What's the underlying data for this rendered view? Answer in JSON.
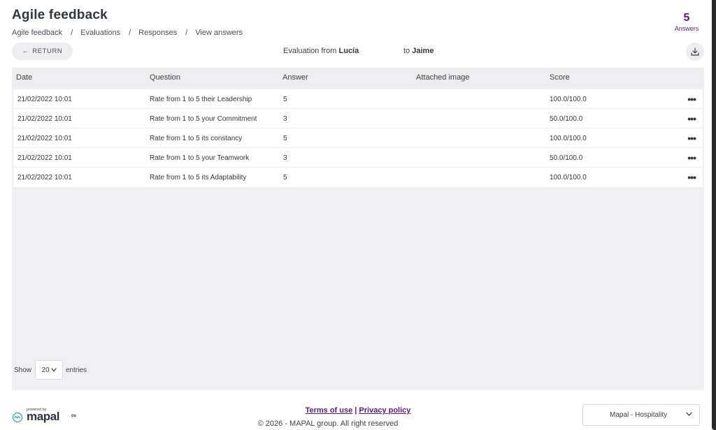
{
  "header": {
    "title": "Agile feedback",
    "breadcrumbs": [
      "Agile feedback",
      "Evaluations",
      "Responses",
      "View answers"
    ],
    "separator": "/",
    "answers_count": "5",
    "answers_label": "Answers"
  },
  "toolbar": {
    "return_label": "RETURN",
    "return_arrow": "←",
    "evaluation_prefix": "Evaluation from",
    "evaluation_from": "Lucía",
    "evaluation_to_prefix": "to",
    "evaluation_to": "Jaime",
    "download_icon": "download-icon"
  },
  "table": {
    "headers": [
      "Date",
      "Question",
      "Answer",
      "Attached image",
      "Score"
    ],
    "rows": [
      {
        "date": "21/02/2022 10:01",
        "question": "Rate from 1 to 5 their Leadership",
        "answer": "5",
        "attached_image": "",
        "score": "100.0/100.0",
        "more": "•••"
      },
      {
        "date": "21/02/2022 10:01",
        "question": "Rate from 1 to 5 your Commitment",
        "answer": "3",
        "attached_image": "",
        "score": "50.0/100.0",
        "more": "•••"
      },
      {
        "date": "21/02/2022 10:01",
        "question": "Rate from 1 to 5 its constancy",
        "answer": "5",
        "attached_image": "",
        "score": "100.0/100.0",
        "more": "•••"
      },
      {
        "date": "21/02/2022 10:01",
        "question": "Rate from 1 to 5 your Teamwork",
        "answer": "3",
        "attached_image": "",
        "score": "50.0/100.0",
        "more": "•••"
      },
      {
        "date": "21/02/2022 10:01",
        "question": "Rate from 1 to 5 its Adaptability",
        "answer": "5",
        "attached_image": "",
        "score": "100.0/100.0",
        "more": "•••"
      }
    ]
  },
  "pagination": {
    "show_label": "Show",
    "entries_value": "20",
    "entries_label": "entries"
  },
  "footer": {
    "terms": "Terms of use",
    "pipe": "|",
    "privacy": "Privacy policy",
    "copyright": "© 2026 - MAPAL group. All right reserved",
    "powered_by": "powered by",
    "logo_text": "mapal",
    "logo_suffix": "os",
    "company_select": "Mapal - Hospitality"
  },
  "colors": {
    "accent": "#5c1a73",
    "text": "#3b3f4a",
    "table_bg": "#f0f0f2"
  }
}
